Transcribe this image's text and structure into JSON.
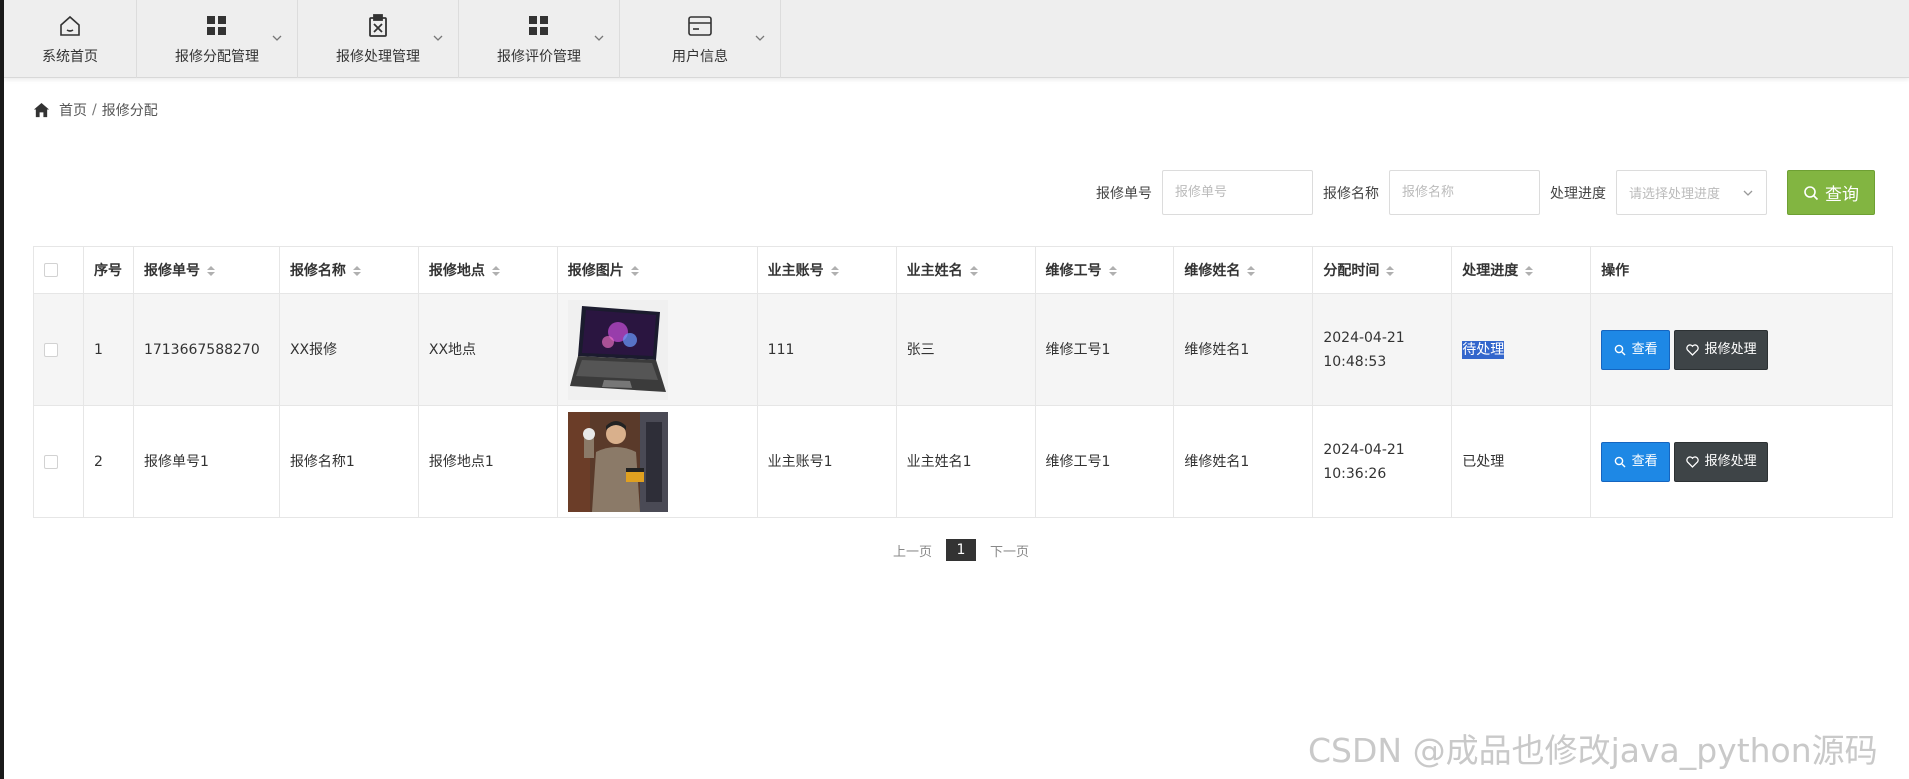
{
  "nav": {
    "items": [
      {
        "label": "系统首页",
        "icon": "home-icon"
      },
      {
        "label": "报修分配管理",
        "icon": "grid-icon"
      },
      {
        "label": "报修处理管理",
        "icon": "clipboard-x-icon"
      },
      {
        "label": "报修评价管理",
        "icon": "grid-icon"
      },
      {
        "label": "用户信息",
        "icon": "card-icon"
      }
    ]
  },
  "breadcrumb": {
    "home": "首页",
    "separator": "/",
    "current": "报修分配"
  },
  "search": {
    "order_label": "报修单号",
    "order_placeholder": "报修单号",
    "name_label": "报修名称",
    "name_placeholder": "报修名称",
    "progress_label": "处理进度",
    "progress_placeholder": "请选择处理进度",
    "query_button": "查询"
  },
  "table": {
    "headers": [
      "序号",
      "报修单号",
      "报修名称",
      "报修地点",
      "报修图片",
      "业主账号",
      "业主姓名",
      "维修工号",
      "维修姓名",
      "分配时间",
      "处理进度",
      "操作"
    ],
    "rows": [
      {
        "index": "1",
        "order_no": "1713667588270",
        "name": "XX报修",
        "location": "XX地点",
        "image": "laptop-image",
        "owner_account": "111",
        "owner_name": "张三",
        "worker_id": "维修工号1",
        "worker_name": "维修姓名1",
        "assign_time": "2024-04-21 10:48:53",
        "progress": "待处理"
      },
      {
        "index": "2",
        "order_no": "报修单号1",
        "name": "报修名称1",
        "location": "报修地点1",
        "image": "repairman-image",
        "owner_account": "业主账号1",
        "owner_name": "业主姓名1",
        "worker_id": "维修工号1",
        "worker_name": "维修姓名1",
        "assign_time": "2024-04-21 10:36:26",
        "progress": "已处理"
      }
    ],
    "view_button": "查看",
    "process_button": "报修处理"
  },
  "pagination": {
    "prev": "上一页",
    "current": "1",
    "next": "下一页"
  },
  "watermark": "CSDN @成品也修改java_python源码",
  "colors": {
    "query_button": "#82b541",
    "view_button": "#1e88e5",
    "process_button": "#3e4447",
    "nav_bg": "#eeeeee"
  }
}
